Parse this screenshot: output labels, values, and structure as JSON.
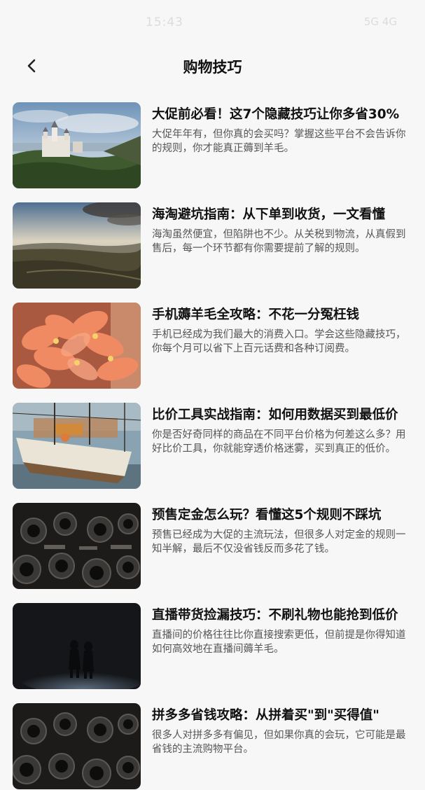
{
  "status": {
    "time": "15:43",
    "right": "5G 4G"
  },
  "header": {
    "title": "购物技巧"
  },
  "articles": [
    {
      "title": "大促前必看！这7个隐藏技巧让你多省30%",
      "desc": "大促年年有，但你真的会买吗？掌握这些平台不会告诉你的规则，你才能真正薅到羊毛。",
      "image": "castle-landscape"
    },
    {
      "title": "海淘避坑指南：从下单到收货，一文看懂",
      "desc": "海淘虽然便宜，但陷阱也不少。从关税到物流，从真假到售后，每一个环节都有你需要提前了解的规则。",
      "image": "hills-landscape"
    },
    {
      "title": "手机薅羊毛全攻略：不花一分冤枉钱",
      "desc": "手机已经成为我们最大的消费入口。学会这些隐藏技巧，你每个月可以省下上百元话费和各种订阅费。",
      "image": "flowers"
    },
    {
      "title": "比价工具实战指南：如何用数据买到最低价",
      "desc": "你是否好奇同样的商品在不同平台价格为何差这么多？用好比价工具，你就能穿透价格迷雾，买到真正的低价。",
      "image": "boat-harbor"
    },
    {
      "title": "预售定金怎么玩？看懂这5个规则不踩坑",
      "desc": "预售已经成为大促的主流玩法，但很多人对定金的规则一知半解，最后不仅没省钱反而多花了钱。",
      "image": "cameras"
    },
    {
      "title": "直播带货捡漏技巧：不刷礼物也能抢到低价",
      "desc": "直播间的价格往往比你直接搜索更低，但前提是你得知道如何高效地在直播间薅羊毛。",
      "image": "night-couple"
    },
    {
      "title": "拼多多省钱攻略：从拼着买\"到\"买得值\"",
      "desc": "很多人对拼多多有偏见，但如果你真的会玩，它可能是最省钱的主流购物平台。",
      "image": "cameras"
    }
  ]
}
